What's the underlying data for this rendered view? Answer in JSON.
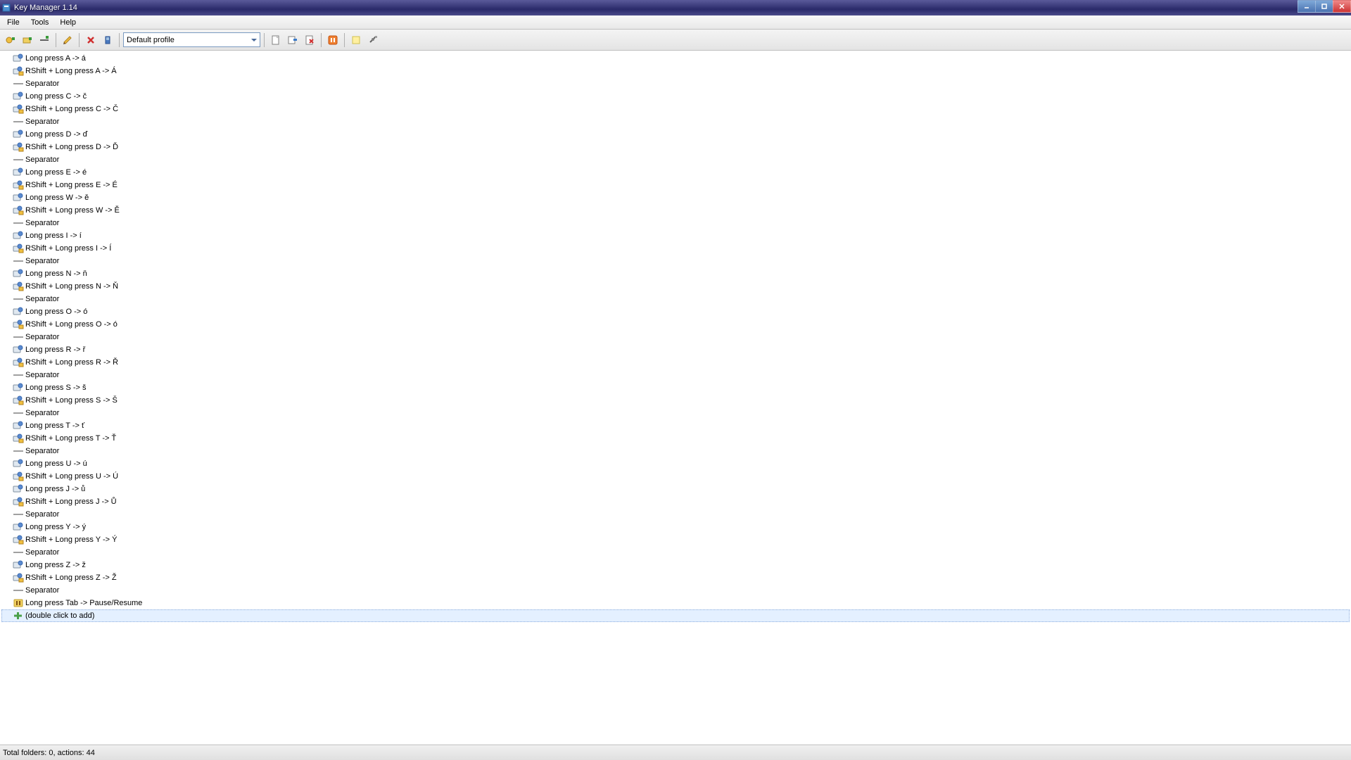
{
  "app": {
    "title": "Key Manager 1.14"
  },
  "menu": {
    "file": "File",
    "tools": "Tools",
    "help": "Help"
  },
  "toolbar": {
    "profile_selected": "Default profile"
  },
  "statusbar": {
    "text": "Total folders: 0, actions: 44"
  },
  "list": {
    "add_placeholder": "(double click to add)",
    "items": [
      {
        "type": "key",
        "label": "Long press A -> á"
      },
      {
        "type": "key_shift",
        "label": "RShift + Long press A -> Á"
      },
      {
        "type": "sep",
        "label": "Separator"
      },
      {
        "type": "key",
        "label": "Long press C -> č"
      },
      {
        "type": "key_shift",
        "label": "RShift + Long press C -> Č"
      },
      {
        "type": "sep",
        "label": "Separator"
      },
      {
        "type": "key",
        "label": "Long press D -> ď"
      },
      {
        "type": "key_shift",
        "label": "RShift + Long press D -> Ď"
      },
      {
        "type": "sep",
        "label": "Separator"
      },
      {
        "type": "key",
        "label": "Long press E -> é"
      },
      {
        "type": "key_shift",
        "label": "RShift + Long press E -> É"
      },
      {
        "type": "key",
        "label": "Long press W -> ě"
      },
      {
        "type": "key_shift",
        "label": "RShift + Long press W -> Ě"
      },
      {
        "type": "sep",
        "label": "Separator"
      },
      {
        "type": "key",
        "label": "Long press I -> í"
      },
      {
        "type": "key_shift",
        "label": "RShift + Long press I -> Í"
      },
      {
        "type": "sep",
        "label": "Separator"
      },
      {
        "type": "key",
        "label": "Long press N -> ň"
      },
      {
        "type": "key_shift",
        "label": "RShift + Long press N -> Ň"
      },
      {
        "type": "sep",
        "label": "Separator"
      },
      {
        "type": "key",
        "label": "Long press O -> ó"
      },
      {
        "type": "key_shift",
        "label": "RShift + Long press O -> ó"
      },
      {
        "type": "sep",
        "label": "Separator"
      },
      {
        "type": "key",
        "label": "Long press R -> ř"
      },
      {
        "type": "key_shift",
        "label": "RShift + Long press R -> Ř"
      },
      {
        "type": "sep",
        "label": "Separator"
      },
      {
        "type": "key",
        "label": "Long press S -> š"
      },
      {
        "type": "key_shift",
        "label": "RShift + Long press S -> Š"
      },
      {
        "type": "sep",
        "label": "Separator"
      },
      {
        "type": "key",
        "label": "Long press T -> ť"
      },
      {
        "type": "key_shift",
        "label": "RShift + Long press T -> Ť"
      },
      {
        "type": "sep",
        "label": "Separator"
      },
      {
        "type": "key",
        "label": "Long press U -> ú"
      },
      {
        "type": "key_shift",
        "label": "RShift + Long press U -> Ú"
      },
      {
        "type": "key",
        "label": "Long press J -> ů"
      },
      {
        "type": "key_shift",
        "label": "RShift + Long press J -> Ů"
      },
      {
        "type": "sep",
        "label": "Separator"
      },
      {
        "type": "key",
        "label": "Long press Y -> ý"
      },
      {
        "type": "key_shift",
        "label": "RShift + Long press Y -> Ý"
      },
      {
        "type": "sep",
        "label": "Separator"
      },
      {
        "type": "key",
        "label": "Long press Z -> ž"
      },
      {
        "type": "key_shift",
        "label": "RShift + Long press Z -> Ž"
      },
      {
        "type": "sep",
        "label": "Separator"
      },
      {
        "type": "pause",
        "label": "Long press Tab -> Pause/Resume"
      }
    ]
  }
}
